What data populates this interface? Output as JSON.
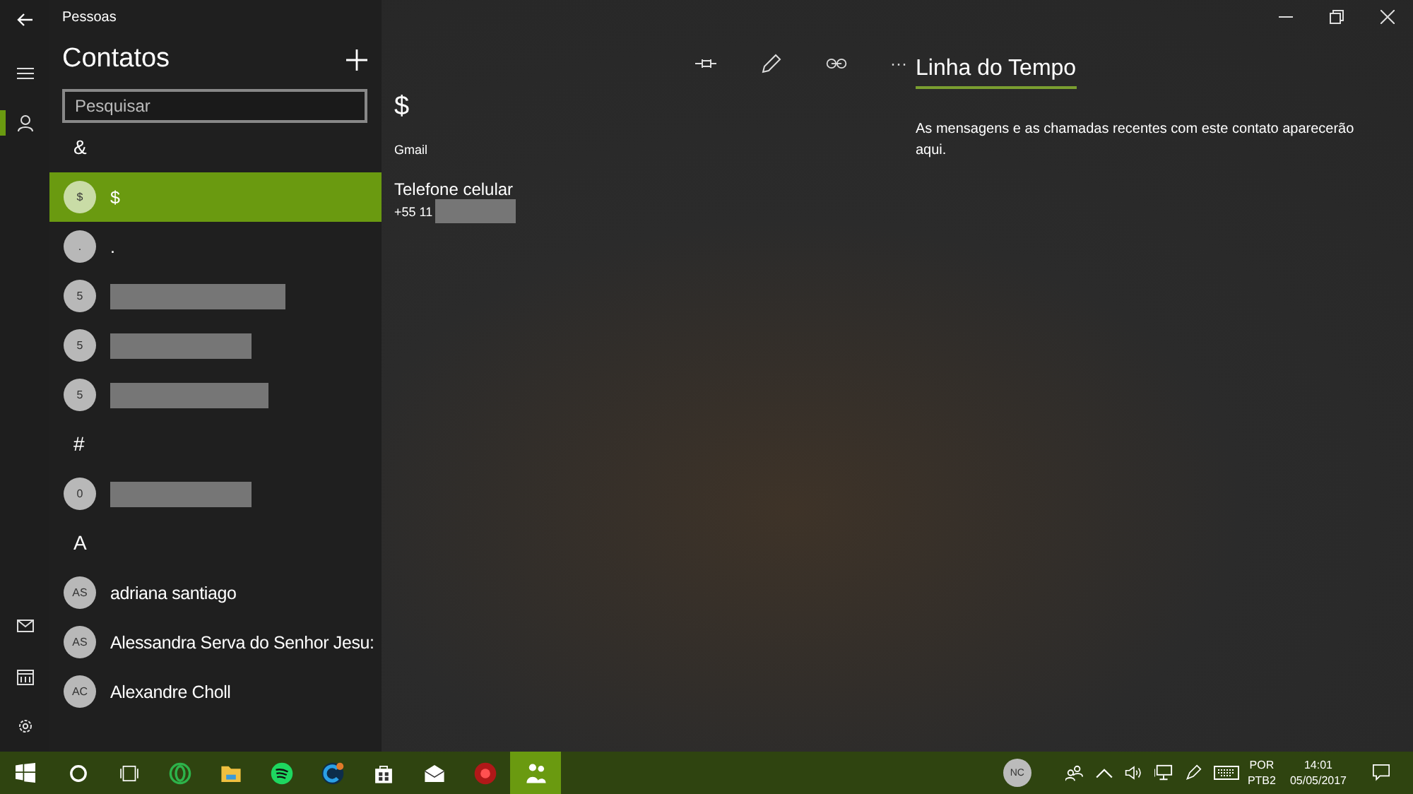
{
  "window": {
    "title": "Pessoas"
  },
  "list": {
    "title": "Contatos",
    "search": {
      "placeholder": "Pesquisar"
    },
    "groups": [
      {
        "letter": "&",
        "contacts": [
          {
            "initials": "$",
            "name": "$",
            "redacted": false,
            "selected": true
          },
          {
            "initials": ".",
            "name": ".",
            "redacted": false,
            "selected": false
          },
          {
            "initials": "5",
            "redacted": true,
            "selected": false
          },
          {
            "initials": "5",
            "redacted": true,
            "selected": false
          },
          {
            "initials": "5",
            "redacted": true,
            "selected": false
          }
        ]
      },
      {
        "letter": "#",
        "contacts": [
          {
            "initials": "0",
            "redacted": true,
            "selected": false
          }
        ]
      },
      {
        "letter": "A",
        "contacts": [
          {
            "initials": "AS",
            "name": "adriana santiago",
            "redacted": false,
            "selected": false
          },
          {
            "initials": "AS",
            "name": "Alessandra Serva do Senhor Jesu:",
            "redacted": false,
            "selected": false
          },
          {
            "initials": "AC",
            "name": "Alexandre Choll",
            "redacted": false,
            "selected": false
          }
        ]
      }
    ]
  },
  "detail": {
    "name": "$",
    "source": "Gmail",
    "phone_label": "Telefone celular",
    "phone_prefix": "+55 11",
    "phone_redacted": true,
    "more": "···"
  },
  "timeline": {
    "title": "Linha do Tempo",
    "message": "As mensagens e as chamadas recentes com este contato aparecerão aqui."
  },
  "taskbar": {
    "apps": [
      {
        "selected": false
      },
      {
        "selected": false
      },
      {
        "selected": false
      },
      {
        "selected": false
      },
      {
        "selected": false
      },
      {
        "selected": false
      },
      {
        "selected": false
      },
      {
        "selected": false
      },
      {
        "selected": false
      },
      {
        "selected": true
      }
    ],
    "avatar": "NC",
    "language": "POR",
    "layout": "PTB2",
    "time": "14:01",
    "date": "05/05/2017"
  }
}
